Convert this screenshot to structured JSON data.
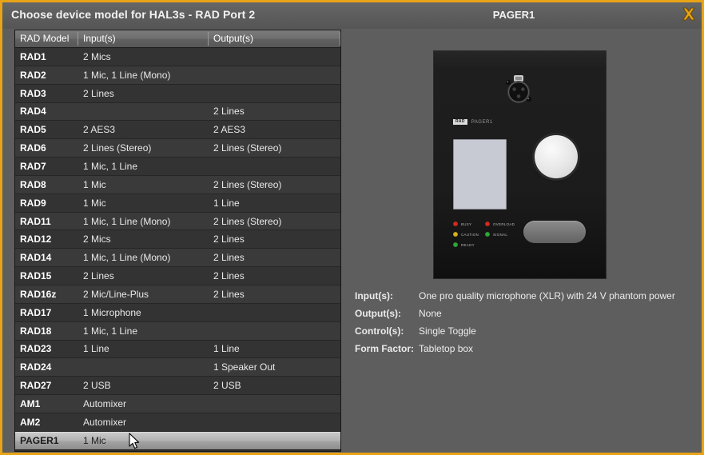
{
  "header": {
    "dialog_title": "Choose device model for HAL3s - RAD Port 2",
    "device_title": "PAGER1",
    "close_icon": "close-icon",
    "accent_color": "#e8a317"
  },
  "table": {
    "columns": [
      "RAD Model",
      "Input(s)",
      "Output(s)"
    ],
    "rows": [
      {
        "model": "RAD1",
        "inputs": "2 Mics",
        "outputs": ""
      },
      {
        "model": "RAD2",
        "inputs": "1 Mic, 1 Line (Mono)",
        "outputs": ""
      },
      {
        "model": "RAD3",
        "inputs": "2 Lines",
        "outputs": ""
      },
      {
        "model": "RAD4",
        "inputs": "",
        "outputs": "2 Lines"
      },
      {
        "model": "RAD5",
        "inputs": "2 AES3",
        "outputs": "2 AES3"
      },
      {
        "model": "RAD6",
        "inputs": "2 Lines (Stereo)",
        "outputs": "2 Lines (Stereo)"
      },
      {
        "model": "RAD7",
        "inputs": "1 Mic, 1 Line",
        "outputs": ""
      },
      {
        "model": "RAD8",
        "inputs": "1 Mic",
        "outputs": "2 Lines (Stereo)"
      },
      {
        "model": "RAD9",
        "inputs": "1 Mic",
        "outputs": "1 Line"
      },
      {
        "model": "RAD11",
        "inputs": "1 Mic, 1 Line (Mono)",
        "outputs": "2 Lines (Stereo)"
      },
      {
        "model": "RAD12",
        "inputs": "2 Mics",
        "outputs": "2 Lines"
      },
      {
        "model": "RAD14",
        "inputs": "1 Mic, 1 Line (Mono)",
        "outputs": "2 Lines"
      },
      {
        "model": "RAD15",
        "inputs": "2 Lines",
        "outputs": "2 Lines"
      },
      {
        "model": "RAD16z",
        "inputs": "2 Mic/Line-Plus",
        "outputs": "2 Lines"
      },
      {
        "model": "RAD17",
        "inputs": "1 Microphone",
        "outputs": ""
      },
      {
        "model": "RAD18",
        "inputs": "1 Mic, 1 Line",
        "outputs": ""
      },
      {
        "model": "RAD23",
        "inputs": "1 Line",
        "outputs": "1 Line"
      },
      {
        "model": "RAD24",
        "inputs": "",
        "outputs": "1 Speaker Out"
      },
      {
        "model": "RAD27",
        "inputs": "2 USB",
        "outputs": "2 USB"
      },
      {
        "model": "AM1",
        "inputs": "Automixer",
        "outputs": ""
      },
      {
        "model": "AM2",
        "inputs": "Automixer",
        "outputs": ""
      },
      {
        "model": "PAGER1",
        "inputs": "1 Mic",
        "outputs": "",
        "selected": true
      }
    ]
  },
  "device": {
    "brand_badge": "RAD",
    "model_label": "PAGER1",
    "leds_left": [
      {
        "label": "BUSY",
        "color": "#d42b1e"
      },
      {
        "label": "CAUTION",
        "color": "#d8b21a"
      },
      {
        "label": "READY",
        "color": "#2fa83a"
      }
    ],
    "leds_right": [
      {
        "label": "OVERLOAD",
        "color": "#d42b1e"
      },
      {
        "label": "SIGNAL",
        "color": "#2fa83a"
      }
    ]
  },
  "specs": [
    {
      "label": "Input(s):",
      "value": "One pro quality microphone (XLR) with 24 V phantom power"
    },
    {
      "label": "Output(s):",
      "value": "None"
    },
    {
      "label": "Control(s):",
      "value": "Single Toggle"
    },
    {
      "label": "Form Factor:",
      "value": "Tabletop box"
    }
  ]
}
